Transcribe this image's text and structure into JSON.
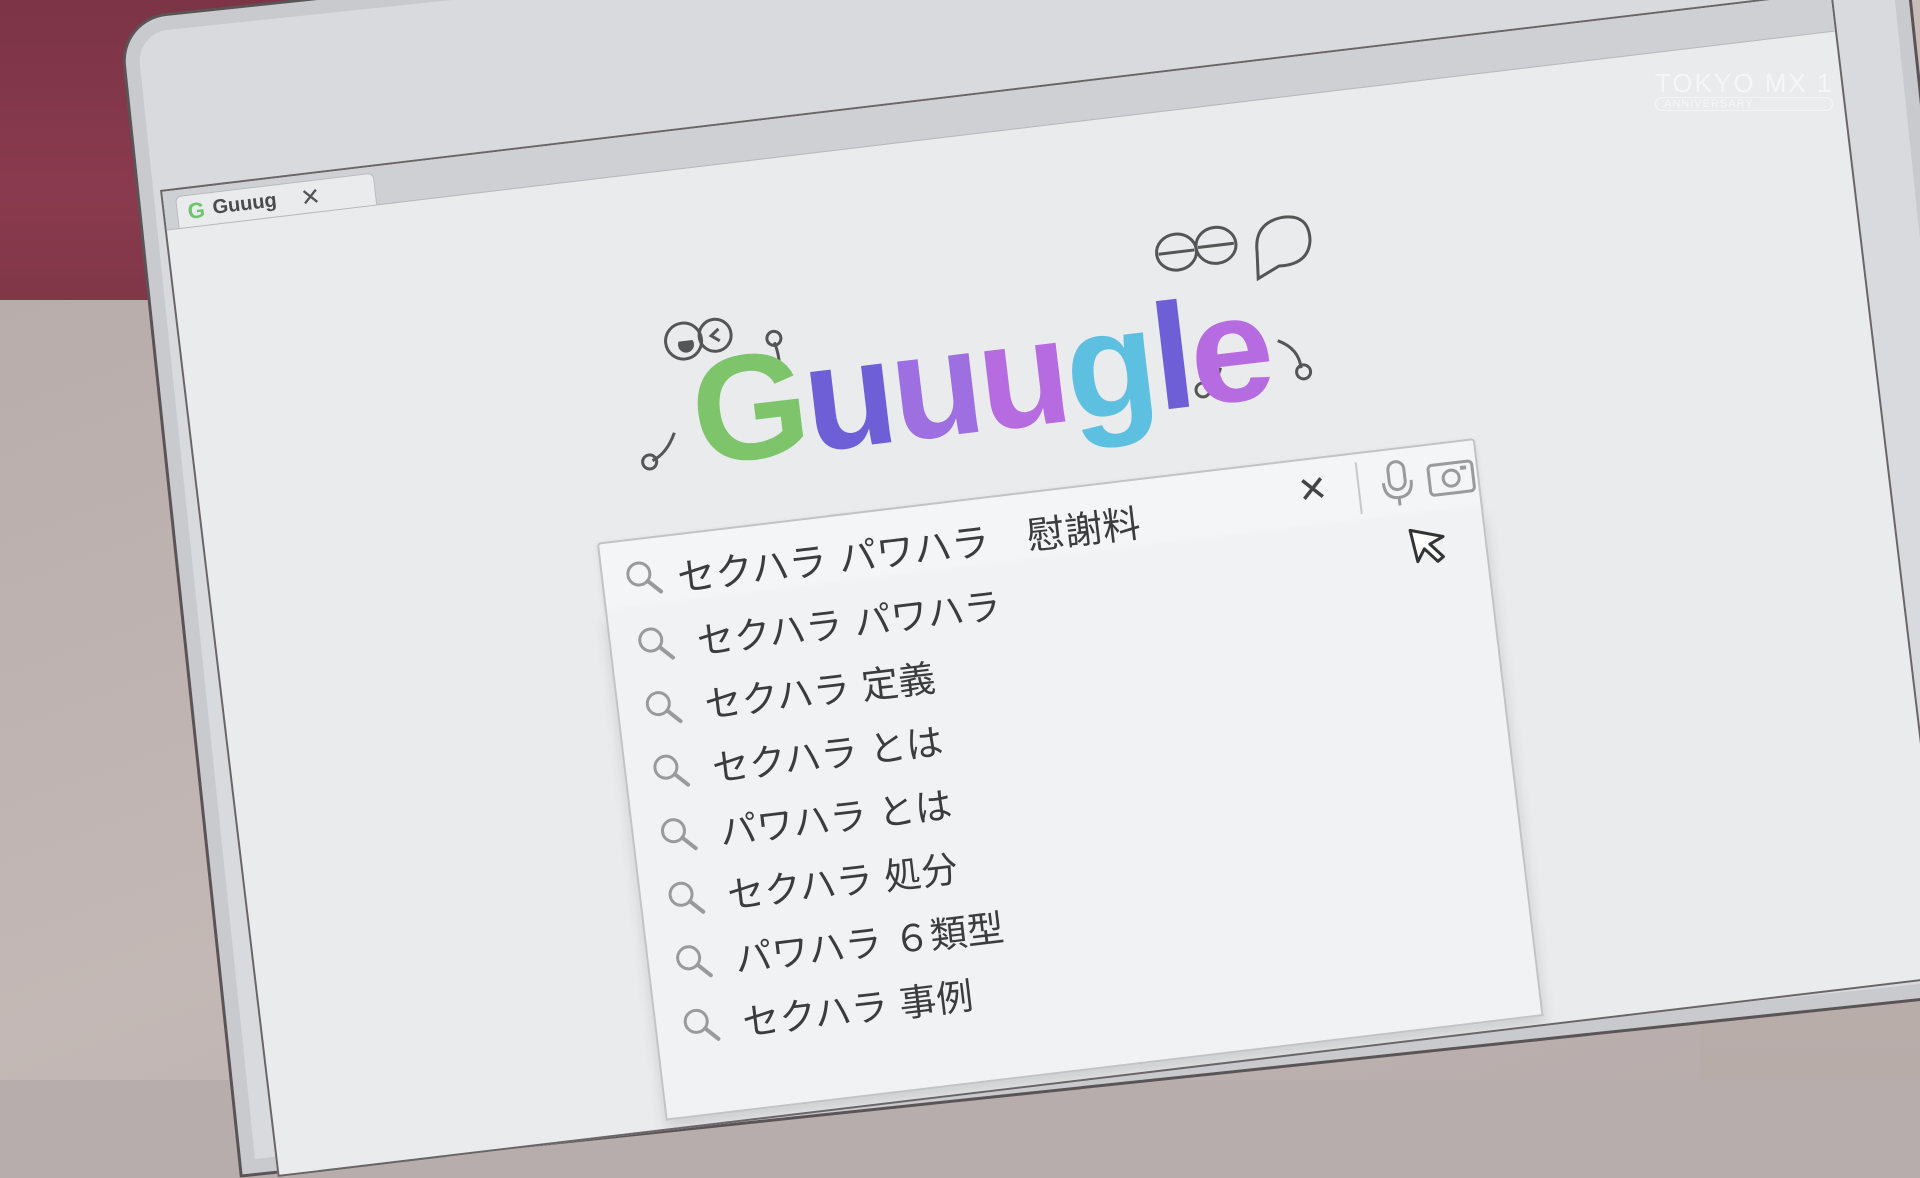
{
  "watermark": {
    "channel": "TOKYO MX 1",
    "sub": "ANNIVERSARY"
  },
  "browser": {
    "tab": {
      "favicon": "G",
      "title": "Guuug",
      "close": "✕"
    }
  },
  "logo": {
    "letters": [
      {
        "char": "G",
        "color": "#7dc46b"
      },
      {
        "char": "u",
        "color": "#6f5fd6"
      },
      {
        "char": "u",
        "color": "#9d6fe0"
      },
      {
        "char": "u",
        "color": "#b66be0"
      },
      {
        "char": "g",
        "color": "#5dc0e0"
      },
      {
        "char": "l",
        "color": "#6f5fd6"
      },
      {
        "char": "e",
        "color": "#b66be0"
      }
    ]
  },
  "search": {
    "query": "セクハラ パワハラ　慰謝料",
    "clear": "✕",
    "icons": [
      "search-icon",
      "mic-icon",
      "camera-icon"
    ]
  },
  "suggestions": [
    "セクハラ パワハラ",
    "セクハラ 定義",
    "セクハラ とは",
    "パワハラ とは",
    "セクハラ 処分",
    "パワハラ ６類型",
    "セクハラ 事例"
  ]
}
